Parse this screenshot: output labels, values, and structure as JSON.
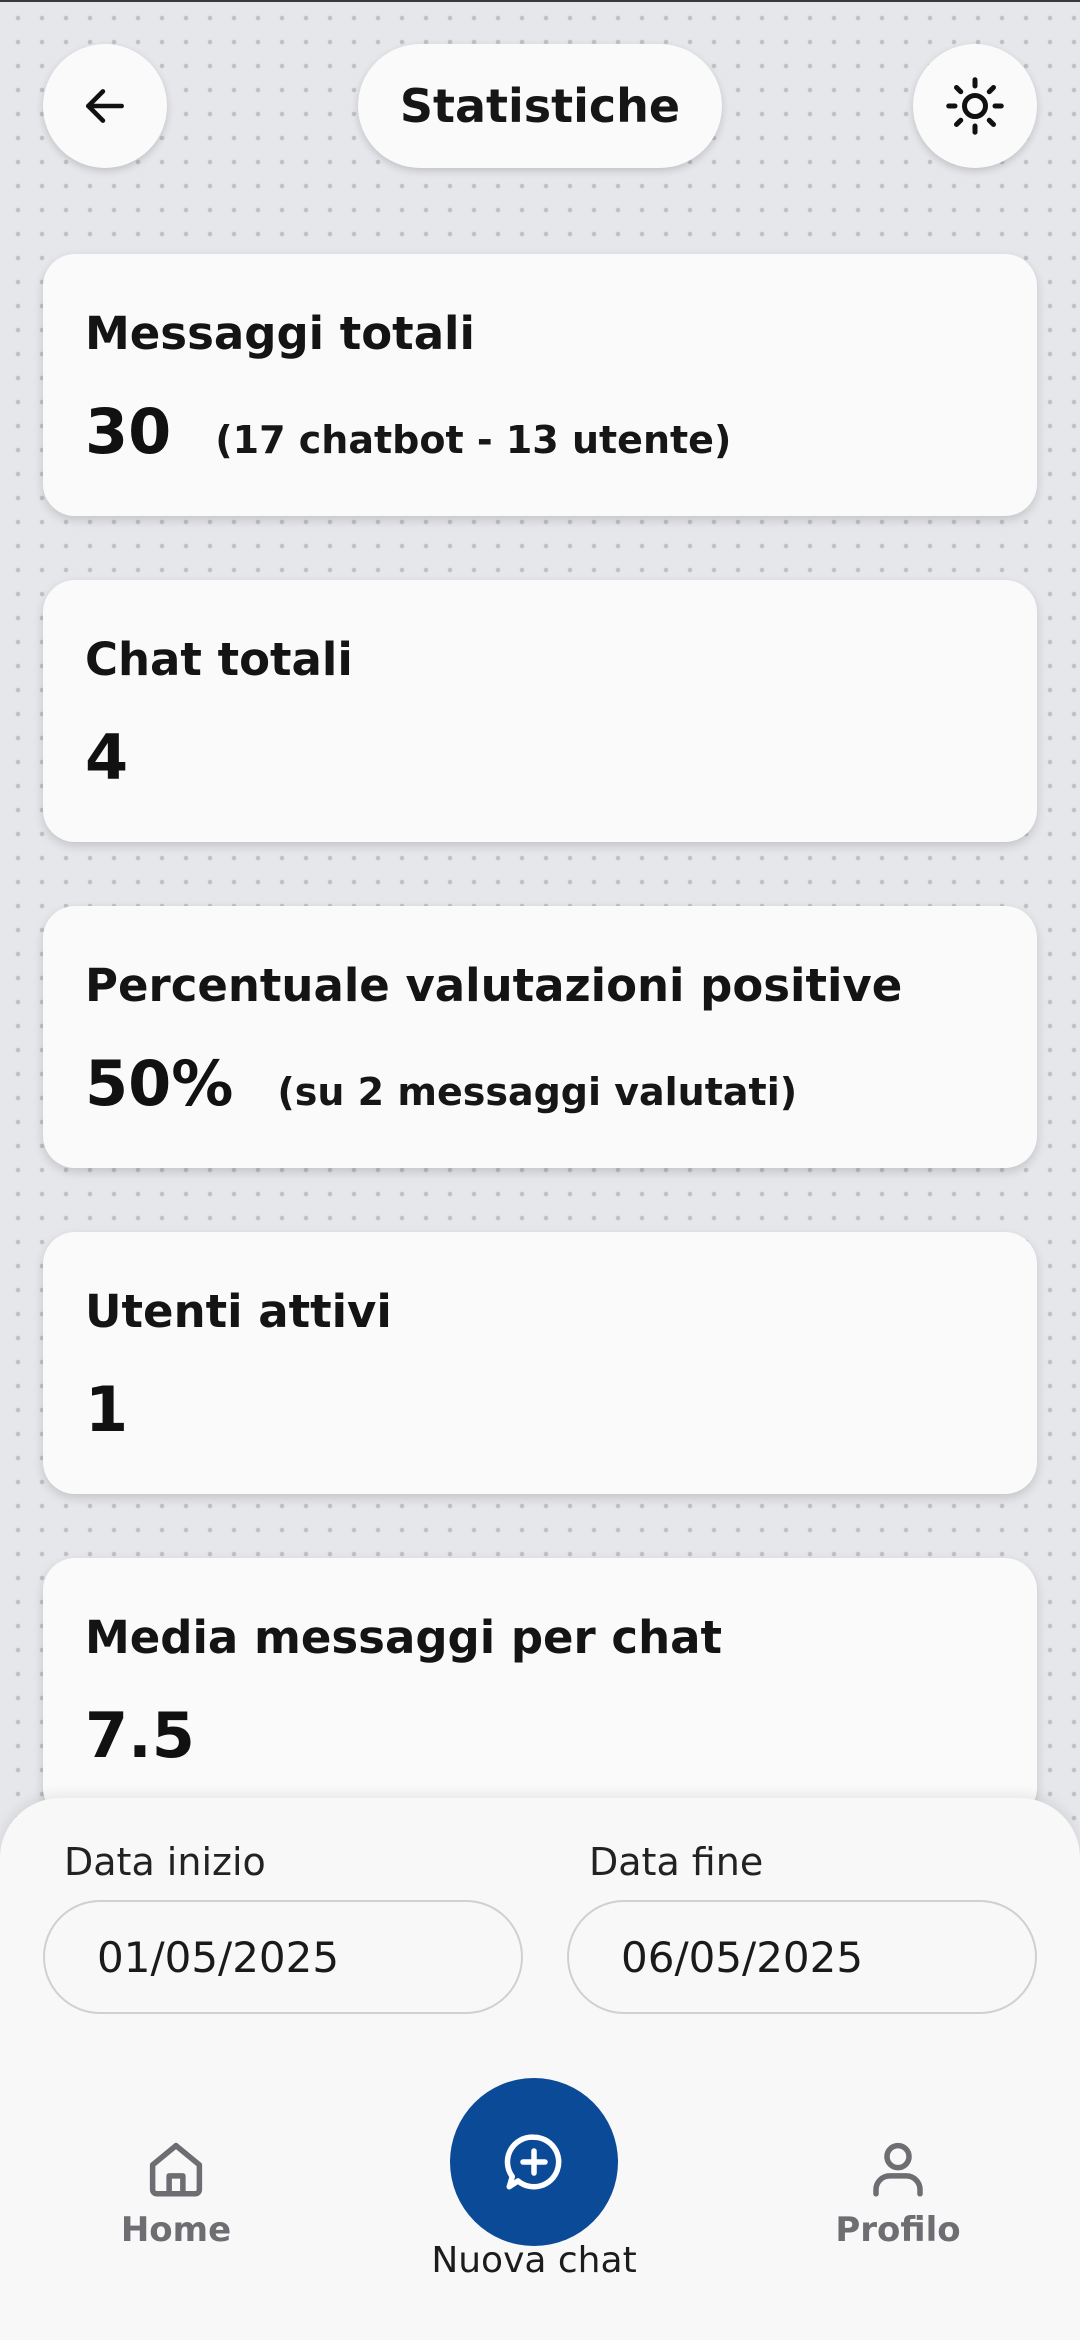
{
  "header": {
    "title": "Statistiche",
    "back_icon": "arrow-left-icon",
    "theme_icon": "sun-icon"
  },
  "stats": [
    {
      "label": "Messaggi totali",
      "value": "30",
      "note": "(17 chatbot - 13 utente)"
    },
    {
      "label": "Chat totali",
      "value": "4",
      "note": ""
    },
    {
      "label": "Percentuale valutazioni positive",
      "value": "50%",
      "note": "(su 2 messaggi valutati)"
    },
    {
      "label": "Utenti attivi",
      "value": "1",
      "note": ""
    },
    {
      "label": "Media messaggi per chat",
      "value": "7.5",
      "note": ""
    }
  ],
  "filters": {
    "start_label": "Data inizio",
    "start_value": "01/05/2025",
    "end_label": "Data fine",
    "end_value": "06/05/2025"
  },
  "nav": {
    "home_label": "Home",
    "new_chat_label": "Nuova chat",
    "profile_label": "Profilo"
  },
  "colors": {
    "accent": "#0b4a96",
    "background": "#e6e7eb",
    "card": "#fafafa",
    "nav_inactive": "#6d6d72"
  }
}
